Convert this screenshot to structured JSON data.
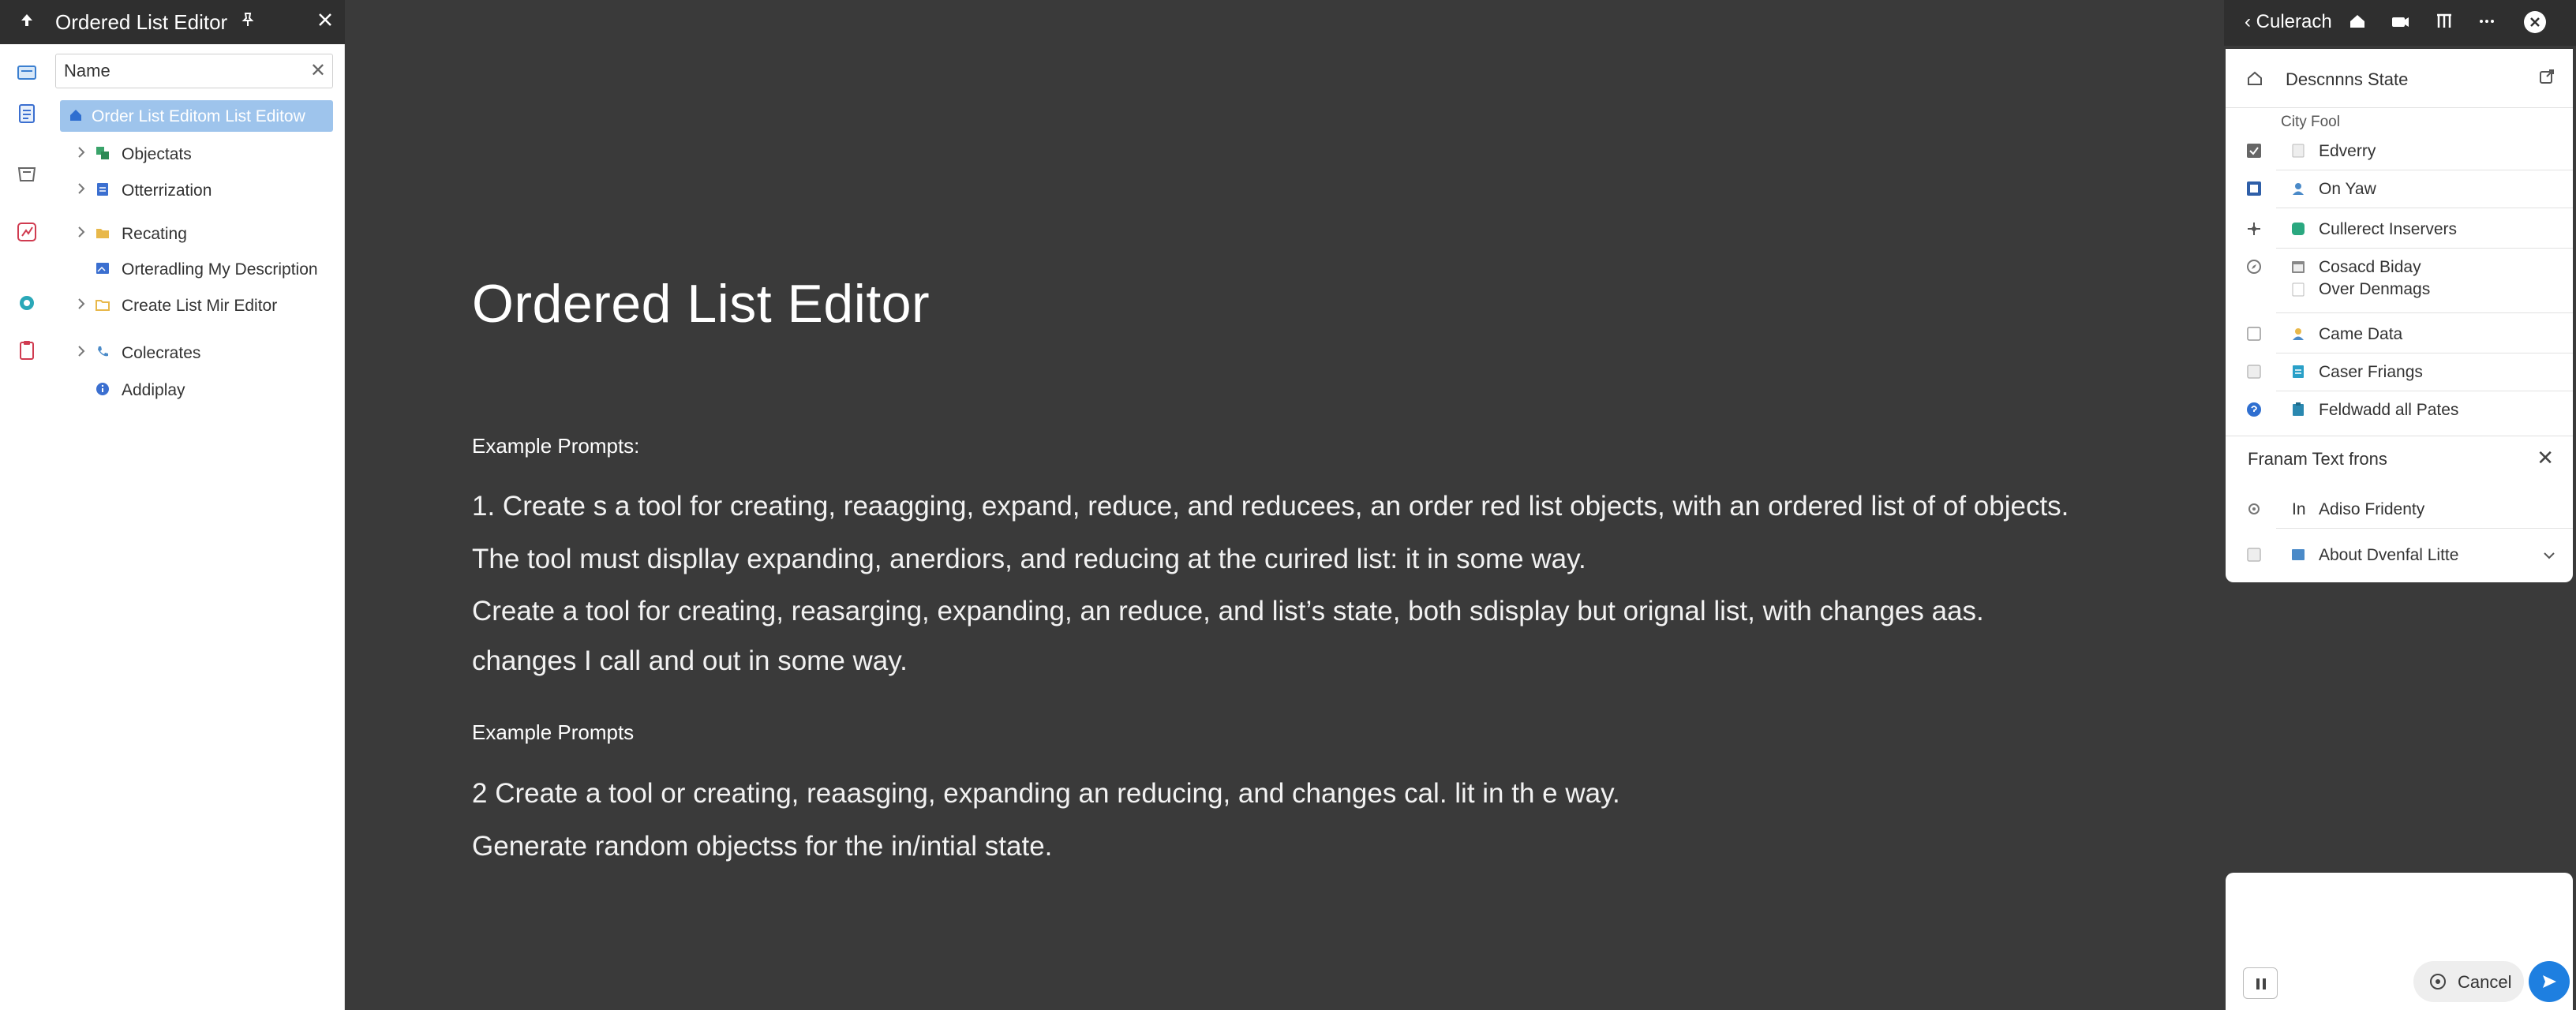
{
  "left_panel": {
    "header": {
      "title": "Ordered List Editor",
      "pin_icon": "pin-icon",
      "close_icon": "close-icon",
      "app_icon": "upload-icon"
    },
    "search": {
      "value": "Name",
      "placeholder": "Name"
    },
    "tree": {
      "selected": "Order List Editom List Editow",
      "items": [
        {
          "label": "Objectats",
          "icon": "shapes-icon",
          "color": "#3aa36a"
        },
        {
          "label": "Otterrization",
          "icon": "document-icon",
          "color": "#3b6fd0"
        },
        {
          "label": "Recating",
          "icon": "folder-icon",
          "color": "#e8b84a"
        },
        {
          "label": "Orteradling My Description",
          "icon": "image-icon",
          "color": "#3b6fd0"
        },
        {
          "label": "Create List Mir Editor",
          "icon": "folder-open-icon",
          "color": "#e8b84a"
        },
        {
          "label": "Colecrates",
          "icon": "phone-icon",
          "color": "#4a8ac8"
        },
        {
          "label": "Addiplay",
          "icon": "info-icon",
          "color": "#3b6fd0"
        }
      ]
    },
    "activity_icons": [
      "inbox-icon",
      "document-icon",
      "archive-icon",
      "chart-icon",
      "gear-icon",
      "clipboard-icon"
    ]
  },
  "main": {
    "title": "Ordered List Editor",
    "sections": [
      {
        "heading": "Example Prompts:",
        "lines": [
          "1. Create s a tool for creating, reaagging, expand, reduce, and reducees, an order red  list objects, with an ordered list of of objects.",
          "The tool must displlay expanding, anerdiors, and reducing at the curired list: it in some way.",
          " Create a tool for creating, reasarging, expanding, an reduce, and list’s state, both sdisplay but orignal list, with changes aas.",
          "changes I call and out in some way."
        ]
      },
      {
        "heading": "Example Prompts",
        "lines": [
          "2 Create a tool or creating, reaasging, expanding an reducing, and changes cal. lit in th e way.",
          "Generate random objectss for the  in/intial state."
        ]
      }
    ]
  },
  "right_panel": {
    "topbar": {
      "back_label": "Culerach",
      "icons": [
        "home-icon",
        "camera-icon",
        "columns-icon",
        "more-icon",
        "close-circle-icon"
      ]
    },
    "header": {
      "label": "Descnnns State"
    },
    "subheader": "City Fool",
    "rows": [
      {
        "label": "Edverry",
        "checked": true,
        "icon_color": "#bbbbbb"
      },
      {
        "label": "On Yaw",
        "checked": true,
        "icon_color": "#4a8ac8"
      },
      {
        "label": "Cullerect Inservers",
        "checked": false,
        "icon_color": "#2aa880"
      },
      {
        "label": "Cosacd Biday",
        "checked": false,
        "icon_color": "#888888"
      },
      {
        "label": "Over Denmags",
        "checked": false,
        "icon_color": "#bbbbbb"
      },
      {
        "label": "Came Data",
        "checked": false,
        "icon_color": "#4a8ac8"
      },
      {
        "label": "Caser Friangs",
        "checked": false,
        "icon_color": "#2aa0c8"
      },
      {
        "label": "Feldwadd all Pates",
        "checked": false,
        "icon_color": "#2a88b0"
      }
    ],
    "section": {
      "label": "Franam Text frons"
    },
    "section_rows": [
      {
        "label": "Adiso Fridenty",
        "prefix": "In"
      },
      {
        "label": "About Dvenfal Litte"
      }
    ]
  },
  "chat": {
    "cancel_label": "Cancel",
    "accent": "#1e7fe0"
  }
}
